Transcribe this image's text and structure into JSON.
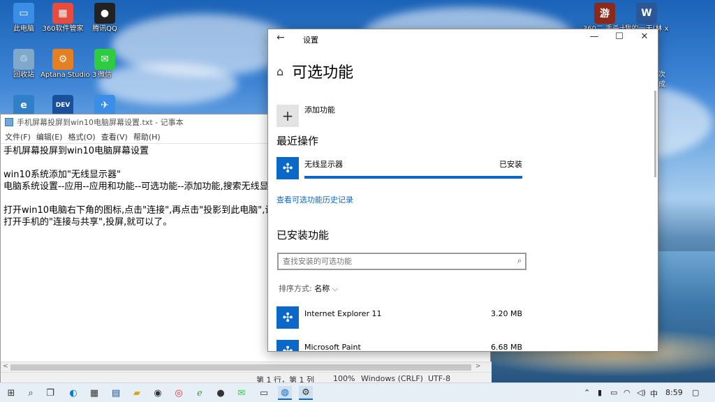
{
  "desktop": {
    "icons": [
      {
        "label": "此电脑",
        "color": "#3a8ee6",
        "glyph": "▭"
      },
      {
        "label": "360软件管家",
        "color": "#e74c3c",
        "glyph": "▦"
      },
      {
        "label": "腾讯QQ",
        "color": "#222222",
        "glyph": "●"
      },
      {
        "label": "回收站",
        "color": "#7fa8c9",
        "glyph": "♲"
      },
      {
        "label": "Aptana Studio 3",
        "color": "#e67e22",
        "glyph": "⚙"
      },
      {
        "label": "微信",
        "color": "#2ecc40",
        "glyph": "✉"
      },
      {
        "label": "",
        "color": "#2f80c8",
        "glyph": "e"
      },
      {
        "label": "",
        "color": "#1a4f9c",
        "glyph": "DEV"
      },
      {
        "label": "",
        "color": "#3a8ee6",
        "glyph": "✈"
      }
    ],
    "right_icons": [
      {
        "label": "360二 手杀十",
        "color": "#8b2a1a",
        "glyph": "游"
      },
      {
        "label": "我的一天(林 x",
        "color": "#2b5797",
        "glyph": "W"
      }
    ],
    "partial_text": [
      "次",
      "成"
    ]
  },
  "notepad": {
    "title": "手机屏幕投屏到win10电脑屏幕设置.txt - 记事本",
    "menu": [
      "文件(F)",
      "编辑(E)",
      "格式(O)",
      "查看(V)",
      "帮助(H)"
    ],
    "content": "手机屏幕投屏到win10电脑屏幕设置\n\nwin10系统添加\"无线显示器\"\n电脑系统设置--应用--应用和功能--可选功能--添加功能,搜索无线显\n\n打开win10电脑右下角的图标,点击\"连接\",再点击\"投影到此电脑\",设置\n打开手机的\"连接与共享\",投屏,就可以了。",
    "status": {
      "position": "第 1 行，第 1 列",
      "zoom": "100%",
      "eol": "Windows (CRLF)",
      "encoding": "UTF-8"
    }
  },
  "settings": {
    "app_title": "设置",
    "page_title": "可选功能",
    "add_feature": "添加功能",
    "recent_heading": "最近操作",
    "recent_item": {
      "name": "无线显示器",
      "status": "已安装",
      "progress": 1.0
    },
    "history_link": "查看可选功能历史记录",
    "installed_heading": "已安装功能",
    "search_placeholder": "查找安装的可选功能",
    "sort_label": "排序方式:",
    "sort_value": "名称",
    "installed": [
      {
        "name": "Internet Explorer 11",
        "size": "3.20 MB"
      },
      {
        "name": "Microsoft Paint",
        "size": "6.68 MB"
      }
    ]
  },
  "taskbar": {
    "time": "8:59",
    "ime": "中",
    "accent": "#0a68c8"
  }
}
